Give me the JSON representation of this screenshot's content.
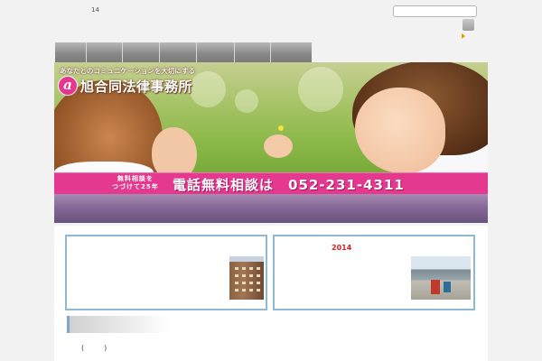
{
  "header": {
    "small_number": "14",
    "search_placeholder": "",
    "search_button_label": ""
  },
  "nav": {
    "items": [
      {
        "label": ""
      },
      {
        "label": ""
      },
      {
        "label": ""
      },
      {
        "label": ""
      },
      {
        "label": ""
      },
      {
        "label": ""
      },
      {
        "label": ""
      }
    ]
  },
  "banner": {
    "tagline": "あなたとのコミュニケーションを大切にする",
    "logo_mark": "a",
    "firm_name": "旭合同法律事務所"
  },
  "phone_bar": {
    "small_line1": "無料相談を",
    "small_line2": "つづけて25年",
    "main_text": "電話無料相談は　052-231-4311"
  },
  "cards": [
    {
      "year": ""
    },
    {
      "year": "2014"
    }
  ],
  "content": {
    "paren_text": "(　　)"
  },
  "colors": {
    "pink": "#e5388f",
    "purple": "#86689a",
    "card_border": "#8fb8d4",
    "year_red": "#d8202a"
  }
}
